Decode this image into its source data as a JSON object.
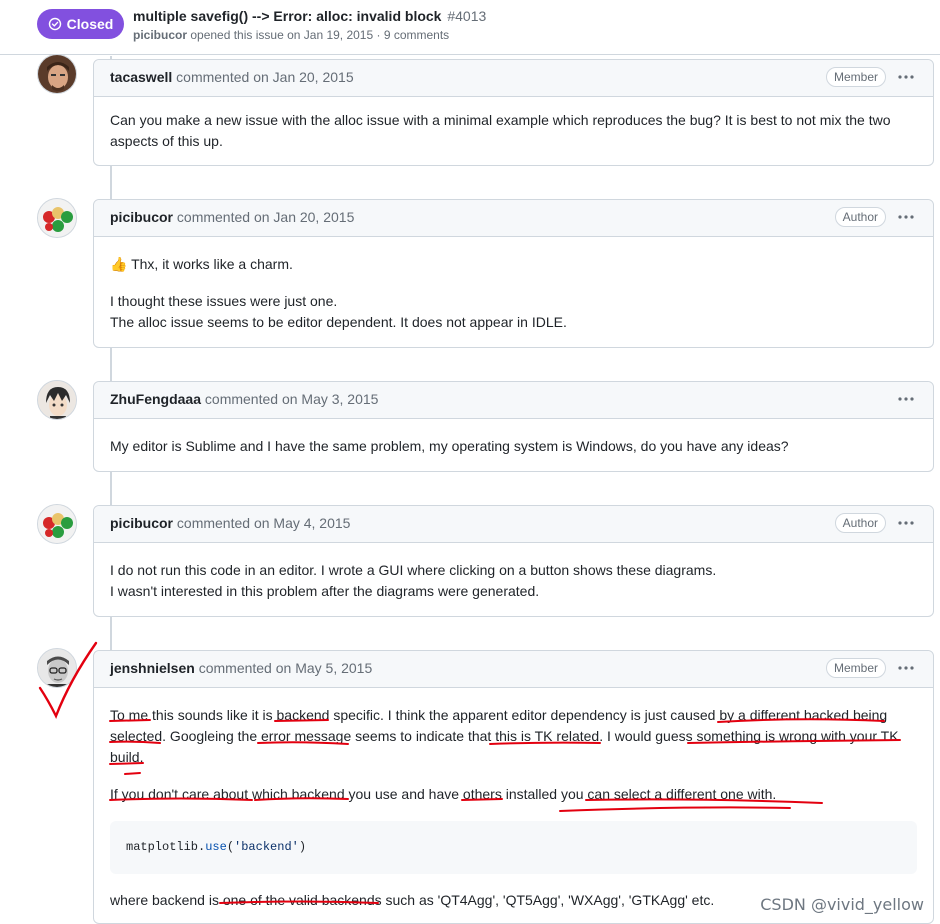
{
  "header": {
    "state": "Closed",
    "title": "multiple savefig() --> Error: alloc: invalid block",
    "number": "#4013",
    "meta_author": "picibucor",
    "meta_text": " opened this issue on Jan 19, 2015 · 9 comments"
  },
  "comments": [
    {
      "author": "tacaswell",
      "date": "commented on Jan 20, 2015",
      "role": "Member",
      "body": [
        "Can you make a new issue with the alloc issue with a minimal example which reproduces the bug? It is best to not mix the two aspects of this up."
      ]
    },
    {
      "author": "picibucor",
      "date": "commented on Jan 20, 2015",
      "role": "Author",
      "emoji": "👍",
      "body": [
        "Thx, it works like a charm.",
        "I thought these issues were just one.",
        "The alloc issue seems to be editor dependent. It does not appear in IDLE."
      ]
    },
    {
      "author": "ZhuFengdaaa",
      "date": "commented on May 3, 2015",
      "role": "",
      "body": [
        "My editor is Sublime and I have the same problem, my operating system is Windows, do you have any ideas?"
      ]
    },
    {
      "author": "picibucor",
      "date": "commented on May 4, 2015",
      "role": "Author",
      "body": [
        "I do not run this code in an editor. I wrote a GUI where clicking on a button shows these diagrams.",
        "I wasn't interested in this problem after the diagrams were generated."
      ]
    },
    {
      "author": "jenshnielsen",
      "date": "commented on May 5, 2015",
      "role": "Member",
      "body": [
        "To me this sounds like it is backend specific. I think the apparent editor dependency is just caused by a different backed being selected. Googleing the error message seems to indicate that this is TK related. I would guess something is wrong with your TK build.",
        "If you don't care about which backend you use and have others installed you can select a different one with.",
        "where backend is one of the valid backends such as 'QT4Agg', 'QT5Agg', 'WXAgg', 'GTKAgg' etc."
      ],
      "code": {
        "prefix": "matplotlib.",
        "fn": "use",
        "open": "(",
        "arg": "'backend'",
        "close": ")"
      }
    }
  ],
  "watermark": "CSDN @vivid_yellow",
  "colors": {
    "closed": "#8250df",
    "annotation": "#e3000f"
  },
  "icons": [
    "check-circle-icon",
    "kebab-horizontal-icon",
    "avatar-image"
  ]
}
